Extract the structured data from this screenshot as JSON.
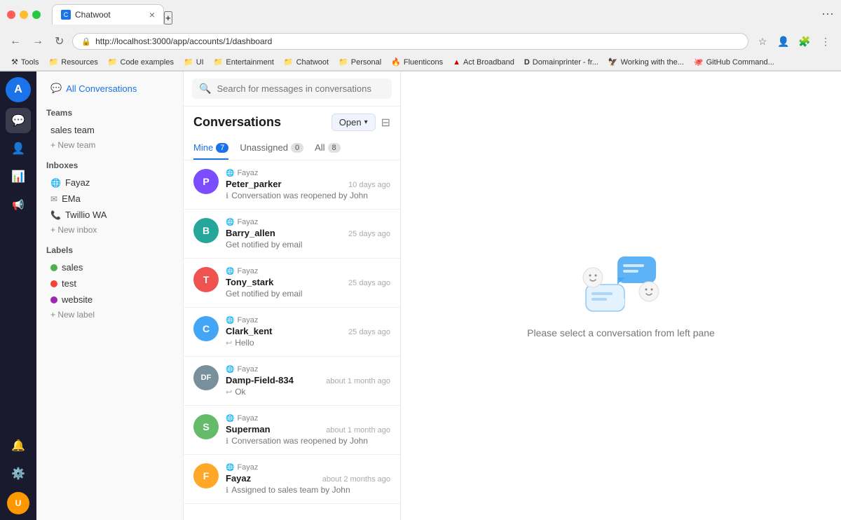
{
  "browser": {
    "url": "http://localhost:3000/app/accounts/1/dashboard",
    "tab_title": "Chatwoot",
    "tab_favicon": "C",
    "bookmarks": [
      {
        "label": "Resources",
        "icon": "📁"
      },
      {
        "label": "Code examples",
        "icon": "📁"
      },
      {
        "label": "UI",
        "icon": "📁"
      },
      {
        "label": "Entertainment",
        "icon": "📁"
      },
      {
        "label": "Chatwoot",
        "icon": "📁"
      },
      {
        "label": "Personal",
        "icon": "📁"
      },
      {
        "label": "Fluenticons",
        "icon": "🔥"
      },
      {
        "label": "Act Broadband",
        "icon": "🔺"
      },
      {
        "label": "Domainprinter - fr...",
        "icon": "D"
      },
      {
        "label": "Working with the...",
        "icon": "🦅"
      },
      {
        "label": "GitHub Command...",
        "icon": "🐙"
      }
    ]
  },
  "sidebar": {
    "icons": [
      {
        "name": "conversations-icon",
        "symbol": "💬",
        "active": true
      },
      {
        "name": "contacts-icon",
        "symbol": "👤",
        "active": false
      },
      {
        "name": "reports-icon",
        "symbol": "📊",
        "active": false
      },
      {
        "name": "notifications-icon",
        "symbol": "🔔",
        "active": false
      },
      {
        "name": "settings-icon",
        "symbol": "⚙️",
        "active": false
      }
    ]
  },
  "left_panel": {
    "all_conversations_label": "All Conversations",
    "teams_section": "Teams",
    "teams": [
      {
        "label": "sales team"
      }
    ],
    "new_team_label": "+ New team",
    "inboxes_section": "Inboxes",
    "inboxes": [
      {
        "label": "Fayaz",
        "icon": "globe"
      },
      {
        "label": "EMa",
        "icon": "mail"
      },
      {
        "label": "Twillio WA",
        "icon": "phone"
      }
    ],
    "new_inbox_label": "+ New inbox",
    "labels_section": "Labels",
    "labels": [
      {
        "label": "sales",
        "color": "green"
      },
      {
        "label": "test",
        "color": "red"
      },
      {
        "label": "website",
        "color": "purple"
      }
    ],
    "new_label_label": "+ New label"
  },
  "conversations": {
    "search_placeholder": "Search for messages in conversations",
    "title": "Conversations",
    "status_button": "Open",
    "tabs": [
      {
        "label": "Mine",
        "count": 7,
        "active": true
      },
      {
        "label": "Unassigned",
        "count": 0,
        "active": false
      },
      {
        "label": "All",
        "count": 8,
        "active": false
      }
    ],
    "items": [
      {
        "inbox": "Fayaz",
        "name": "Peter_parker",
        "time": "10 days ago",
        "preview": "Conversation was reopened by John",
        "preview_icon": "info",
        "avatar_letter": "P",
        "avatar_class": "av-p"
      },
      {
        "inbox": "Fayaz",
        "name": "Barry_allen",
        "time": "25 days ago",
        "preview": "Get notified by email",
        "preview_icon": "none",
        "avatar_letter": "B",
        "avatar_class": "av-b"
      },
      {
        "inbox": "Fayaz",
        "name": "Tony_stark",
        "time": "25 days ago",
        "preview": "Get notified by email",
        "preview_icon": "none",
        "avatar_letter": "T",
        "avatar_class": "av-t"
      },
      {
        "inbox": "Fayaz",
        "name": "Clark_kent",
        "time": "25 days ago",
        "preview": "Hello",
        "preview_icon": "reply",
        "avatar_letter": "C",
        "avatar_class": "av-c"
      },
      {
        "inbox": "Fayaz",
        "name": "Damp-Field-834",
        "time": "about 1 month ago",
        "preview": "Ok",
        "preview_icon": "reply",
        "avatar_letter": "DF",
        "avatar_class": "av-df"
      },
      {
        "inbox": "Fayaz",
        "name": "Superman",
        "time": "about 1 month ago",
        "preview": "Conversation was reopened by John",
        "preview_icon": "info",
        "avatar_letter": "S",
        "avatar_class": "av-s"
      },
      {
        "inbox": "Fayaz",
        "name": "Fayaz",
        "time": "about 2 months ago",
        "preview": "Assigned to sales team by John",
        "preview_icon": "info",
        "avatar_letter": "F",
        "avatar_class": "av-f"
      }
    ]
  },
  "empty_state": {
    "message": "Please select a conversation from left pane"
  }
}
